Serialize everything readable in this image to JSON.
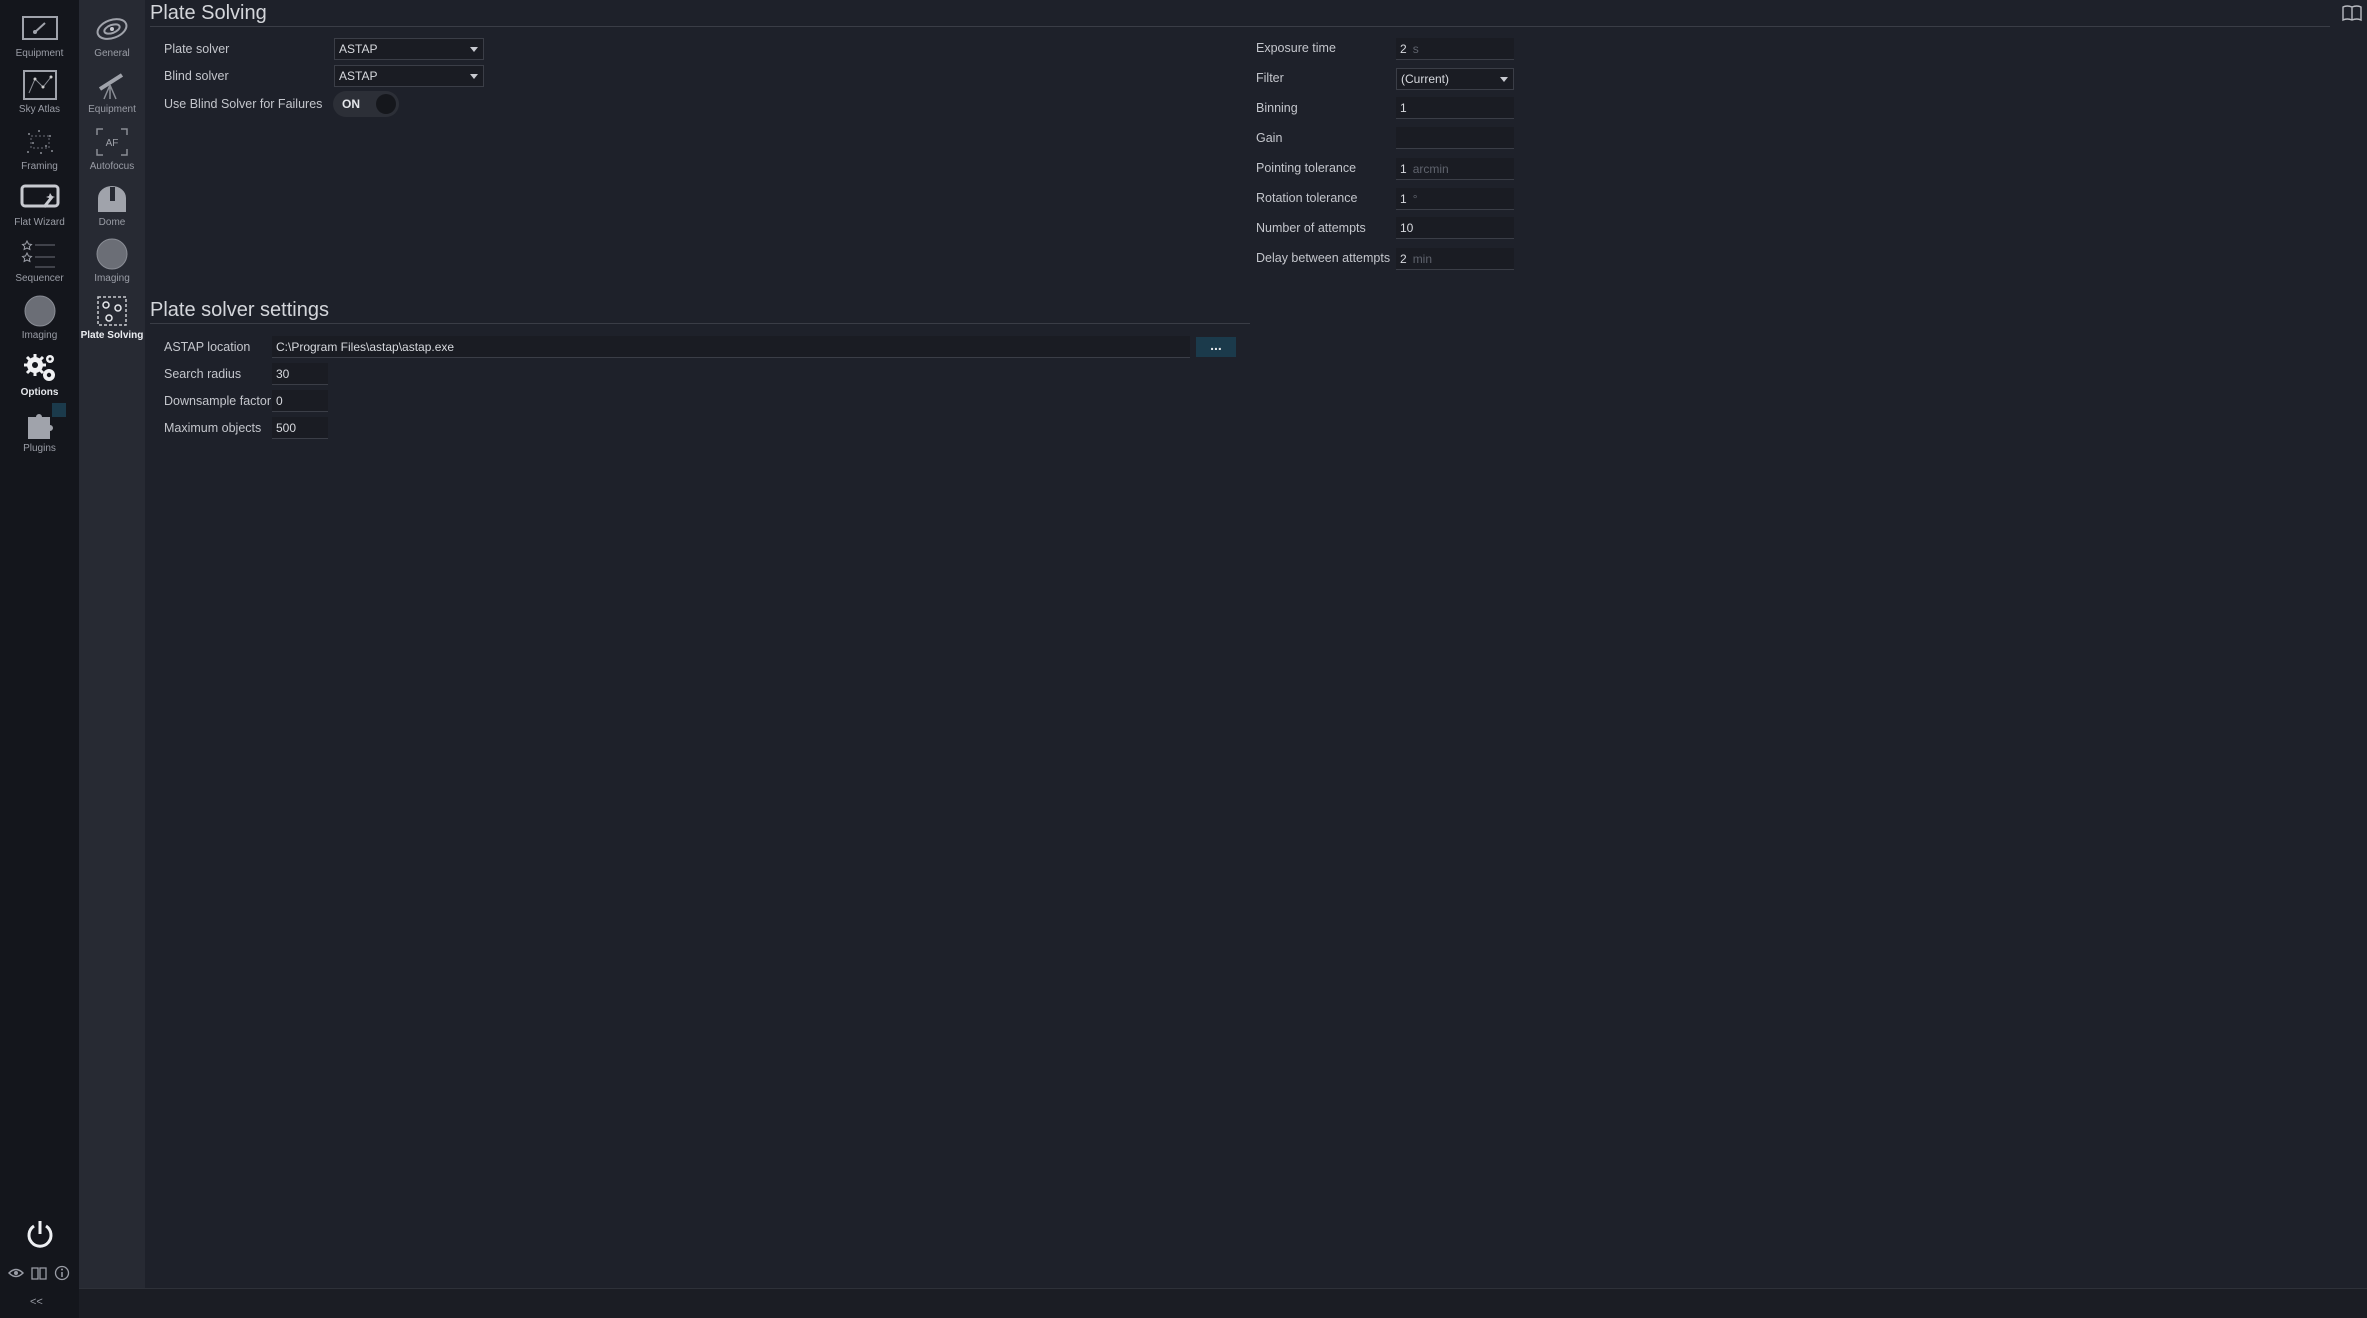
{
  "main_nav": [
    {
      "label": "Equipment",
      "icon": "equipment-icon"
    },
    {
      "label": "Sky Atlas",
      "icon": "sky-atlas-icon"
    },
    {
      "label": "Framing",
      "icon": "framing-icon"
    },
    {
      "label": "Flat Wizard",
      "icon": "flat-wizard-icon"
    },
    {
      "label": "Sequencer",
      "icon": "sequencer-icon"
    },
    {
      "label": "Imaging",
      "icon": "imaging-icon"
    },
    {
      "label": "Options",
      "icon": "options-gears-icon",
      "active": true
    },
    {
      "label": "Plugins",
      "icon": "plugins-puzzle-icon"
    }
  ],
  "options_nav": [
    {
      "label": "General",
      "icon": "general-galaxy-icon"
    },
    {
      "label": "Equipment",
      "icon": "telescope-icon"
    },
    {
      "label": "Autofocus",
      "icon": "autofocus-icon"
    },
    {
      "label": "Dome",
      "icon": "dome-icon"
    },
    {
      "label": "Imaging",
      "icon": "imaging-icon"
    },
    {
      "label": "Plate Solving",
      "icon": "plate-solving-icon",
      "active": true
    }
  ],
  "collapse_label": "<<",
  "plate_solving": {
    "title": "Plate Solving",
    "plate_solver_label": "Plate solver",
    "plate_solver_value": "ASTAP",
    "blind_solver_label": "Blind solver",
    "blind_solver_value": "ASTAP",
    "use_blind_label": "Use Blind Solver for Failures",
    "use_blind_state": "ON",
    "exposure_label": "Exposure time",
    "exposure_value": "2",
    "exposure_unit": "s",
    "filter_label": "Filter",
    "filter_value": "(Current)",
    "binning_label": "Binning",
    "binning_value": "1",
    "gain_label": "Gain",
    "gain_value": "",
    "pointing_label": "Pointing tolerance",
    "pointing_value": "1",
    "pointing_unit": "arcmin",
    "rotation_label": "Rotation tolerance",
    "rotation_value": "1",
    "rotation_unit": "°",
    "attempts_label": "Number of attempts",
    "attempts_value": "10",
    "delay_label": "Delay between attempts",
    "delay_value": "2",
    "delay_unit": "min"
  },
  "solver_settings": {
    "title": "Plate solver settings",
    "astap_location_label": "ASTAP location",
    "astap_location_value": "C:\\Program Files\\astap\\astap.exe",
    "browse_label": "...",
    "search_radius_label": "Search radius",
    "search_radius_value": "30",
    "downsample_label": "Downsample factor",
    "downsample_value": "0",
    "max_objects_label": "Maximum objects",
    "max_objects_value": "500"
  },
  "colors": {
    "background": "#1e212a",
    "sidebar": "#14161c",
    "subsidebar": "#272a33",
    "accent": "#1b3a4b"
  }
}
